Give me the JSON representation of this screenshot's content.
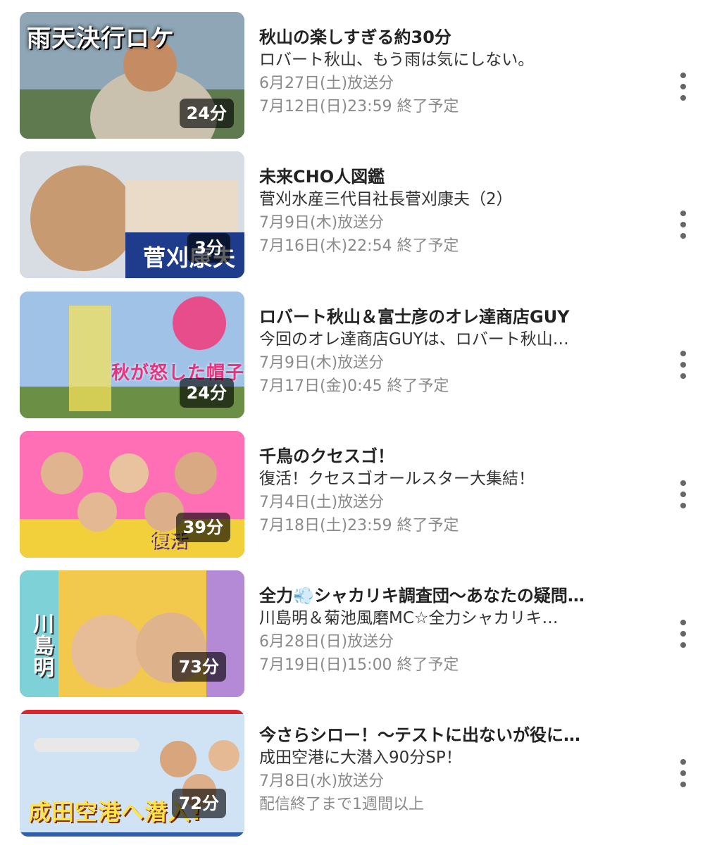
{
  "programs": [
    {
      "thumb_caption": "雨天決行ロケ",
      "duration": "24分",
      "title": "秋山の楽しすぎる約30分",
      "subtitle": "ロバート秋山、もう雨は気にしない。",
      "broadcast": "6月27日(土)放送分",
      "expiry": "7月12日(日)23:59 終了予定",
      "thumb_colors": [
        "#8ea6b6",
        "#5f7a4f",
        "#c9c1ae"
      ]
    },
    {
      "thumb_caption": "菅刈康夫",
      "duration": "3分",
      "title": "未来CHO人図鑑",
      "subtitle": "菅刈水産三代目社長菅刈康夫（2）",
      "broadcast": "7月9日(木)放送分",
      "expiry": "7月16日(木)22:54 終了予定",
      "thumb_colors": [
        "#d8dde4",
        "#c89a72",
        "#1f3b8c"
      ]
    },
    {
      "thumb_caption": "秋が怒した帽子",
      "duration": "24分",
      "title": "ロバート秋山＆富士彦のオレ達商店GUY",
      "subtitle": "今回のオレ達商店GUYは、ロバート秋山…",
      "broadcast": "7月9日(木)放送分",
      "expiry": "7月17日(金)0:45 終了予定",
      "thumb_colors": [
        "#9fc2e6",
        "#6b8f44",
        "#e74c8b"
      ]
    },
    {
      "thumb_caption": "復活",
      "duration": "39分",
      "title": "千鳥のクセスゴ！",
      "subtitle": "復活！クセスゴオールスター大集結！",
      "broadcast": "7月4日(土)放送分",
      "expiry": "7月18日(土)23:59 終了予定",
      "thumb_colors": [
        "#ff6fb5",
        "#f2d03b",
        "#5b2a86"
      ]
    },
    {
      "thumb_caption": "川島明",
      "duration": "73分",
      "title": "全力💨シャカリキ調査団〜あなたの疑問…",
      "subtitle": "川島明＆菊池風磨MC☆全力シャカリキ…",
      "broadcast": "6月28日(日)放送分",
      "expiry": "7月19日(日)15:00 終了予定",
      "thumb_colors": [
        "#f2c94c",
        "#7fd1d8",
        "#b48ad6"
      ]
    },
    {
      "thumb_caption": "成田空港へ潜入!",
      "duration": "72分",
      "title": "今さらシロー！〜テストに出ないが役に…",
      "subtitle": "成田空港に大潜入90分SP！",
      "broadcast": "7月8日(水)放送分",
      "expiry": "配信終了まで1週間以上",
      "thumb_colors": [
        "#cfe3f4",
        "#e8e8e8",
        "#d8262e"
      ]
    }
  ],
  "colors": {
    "title": "#222222",
    "subtitle": "#333333",
    "info": "#8a8a8a",
    "duration_bg": "rgba(0,0,0,0.62)"
  }
}
